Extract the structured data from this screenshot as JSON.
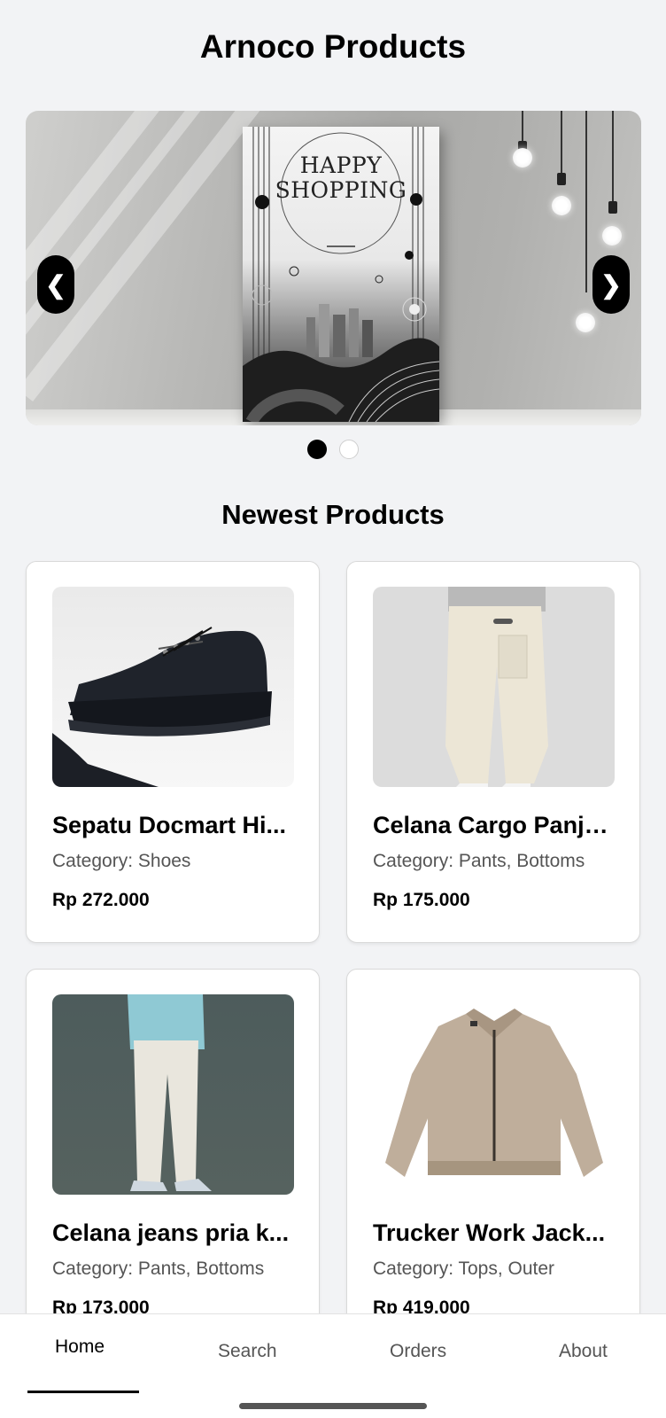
{
  "header": {
    "title": "Arnoco Products"
  },
  "banner": {
    "poster_line1": "HAPPY",
    "poster_line2": "SHOPPING",
    "prev_label": "❮",
    "next_label": "❯",
    "slide_count": 2,
    "active_slide": 1
  },
  "newest": {
    "title": "Newest Products",
    "products": [
      {
        "name": "Sepatu Docmart Hi...",
        "category": "Category: Shoes",
        "price": "Rp 272.000",
        "image": "black-leather-shoe"
      },
      {
        "name": "Celana Cargo Panja...",
        "category": "Category: Pants, Bottoms",
        "price": "Rp 175.000",
        "image": "cream-cargo-pants"
      },
      {
        "name": "Celana jeans pria k...",
        "category": "Category: Pants, Bottoms",
        "price": "Rp 173.000",
        "image": "white-wide-jeans"
      },
      {
        "name": "Trucker Work Jack...",
        "category": "Category: Tops, Outer",
        "price": "Rp 419.000",
        "image": "beige-trucker-jacket"
      }
    ]
  },
  "bottom_nav": {
    "items": [
      {
        "label": "Home"
      },
      {
        "label": "Search"
      },
      {
        "label": "Orders"
      },
      {
        "label": "About"
      }
    ],
    "active": "Home"
  }
}
